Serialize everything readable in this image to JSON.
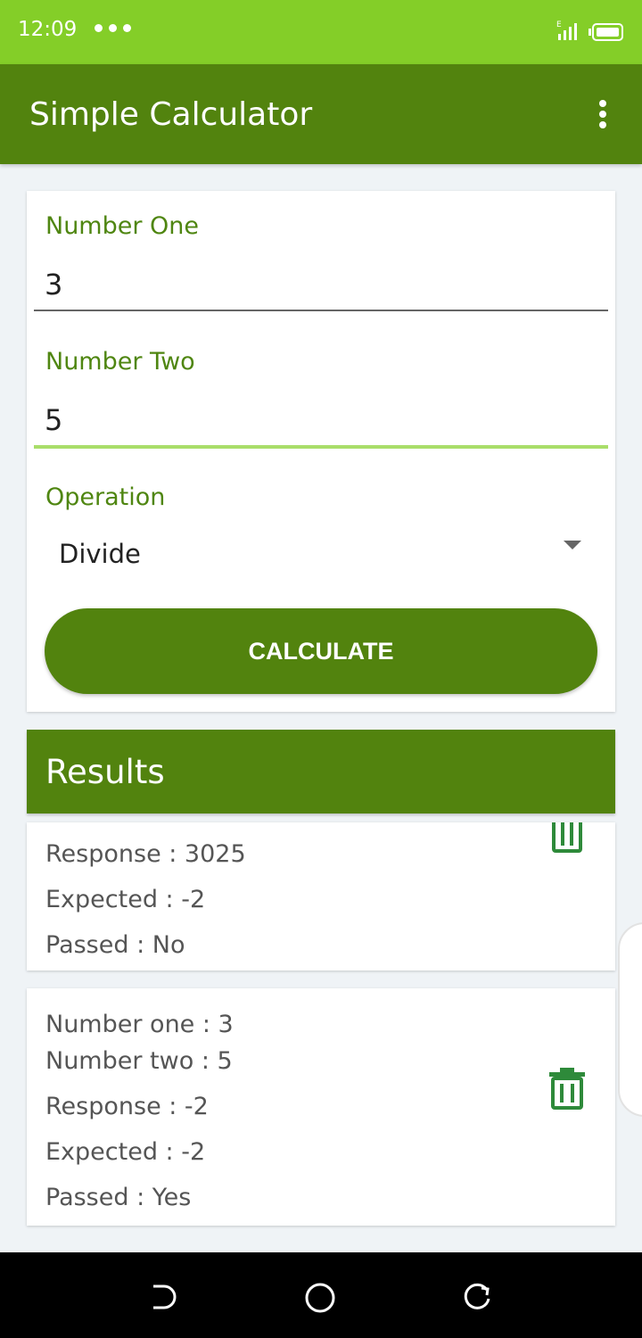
{
  "status_bar": {
    "time": "12:09",
    "network": "E"
  },
  "app_bar": {
    "title": "Simple Calculator",
    "menu_icon": "overflow-menu-icon"
  },
  "form": {
    "number_one": {
      "label": "Number One",
      "value": "3"
    },
    "number_two": {
      "label": "Number Two",
      "value": "5"
    },
    "operation": {
      "label": "Operation",
      "selected": "Divide"
    },
    "calculate_label": "CALCULATE"
  },
  "results": {
    "title": "Results",
    "items": [
      {
        "response": "Response : 3025",
        "expected": "Expected : -2",
        "passed": "Passed : No"
      },
      {
        "number_one": "Number one : 3",
        "number_two": "Number two : 5",
        "response": "Response : -2",
        "expected": "Expected : -2",
        "passed": "Passed : Yes"
      }
    ]
  },
  "colors": {
    "status_bar": "#84ce28",
    "primary": "#52830e",
    "label_green": "#4f8611",
    "focus_underline": "#a9de6a",
    "trash_icon": "#2e8a3a"
  }
}
